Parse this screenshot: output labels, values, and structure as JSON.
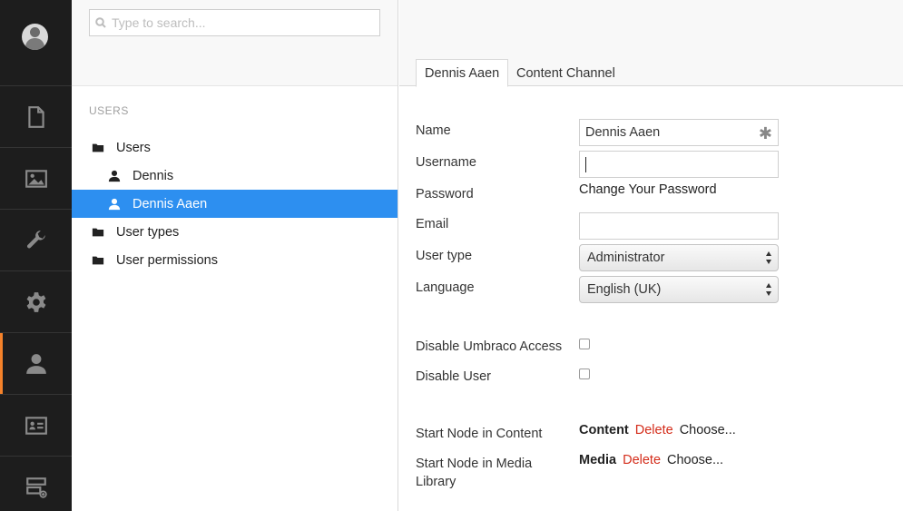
{
  "search": {
    "placeholder": "Type to search..."
  },
  "sections": [
    {
      "icon": "document-icon"
    },
    {
      "icon": "media-icon"
    },
    {
      "icon": "wrench-icon"
    },
    {
      "icon": "gear-icon"
    },
    {
      "icon": "user-icon",
      "active": true
    },
    {
      "icon": "member-card-icon"
    },
    {
      "icon": "forms-icon"
    }
  ],
  "tree": {
    "heading": "USERS",
    "items": [
      {
        "label": "Users"
      },
      {
        "label": "Dennis"
      },
      {
        "label": "Dennis Aaen"
      },
      {
        "label": "User types"
      },
      {
        "label": "User permissions"
      }
    ]
  },
  "tabs": [
    {
      "label": "Dennis Aaen"
    },
    {
      "label": "Content Channel"
    }
  ],
  "form": {
    "name_label": "Name",
    "name_value": "Dennis Aaen",
    "required_mark": "✱",
    "username_label": "Username",
    "username_value": "",
    "password_label": "Password",
    "password_link": "Change Your Password",
    "email_label": "Email",
    "email_value": "",
    "usertype_label": "User type",
    "usertype_value": "Administrator",
    "language_label": "Language",
    "language_value": "English (UK)",
    "disable_access_label": "Disable Umbraco Access",
    "disable_user_label": "Disable User",
    "start_content_label": "Start Node in Content",
    "start_content_value": "Content",
    "start_media_label_1": "Start Node in Media",
    "start_media_label_2": "Library",
    "start_media_value": "Media",
    "delete_label": "Delete",
    "choose_label": "Choose..."
  }
}
